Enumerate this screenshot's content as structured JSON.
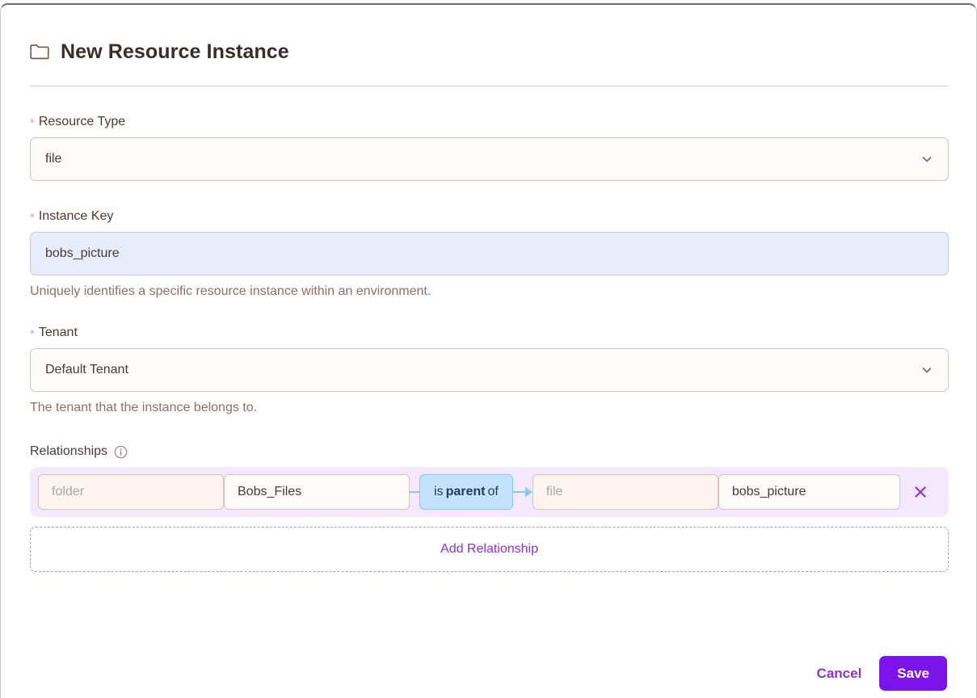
{
  "header": {
    "icon": "folder-icon",
    "title": "New Resource Instance"
  },
  "form": {
    "resource_type": {
      "label": "Resource Type",
      "required_marker": "*",
      "value": "file",
      "chevron": "chevron-down-icon"
    },
    "instance_key": {
      "label": "Instance Key",
      "required_marker": "*",
      "value": "bobs_picture",
      "help": "Uniquely identifies a specific resource instance within an environment."
    },
    "tenant": {
      "label": "Tenant",
      "required_marker": "*",
      "value": "Default Tenant",
      "chevron": "chevron-down-icon",
      "help": "The tenant that the instance belongs to."
    }
  },
  "relationships": {
    "label": "Relationships",
    "info_icon": "info-circle-icon",
    "rows": [
      {
        "subject_type_placeholder": "folder",
        "subject_key": "Bobs_Files",
        "relation_prefix": "is",
        "relation_name": "parent",
        "relation_suffix": "of",
        "object_type_placeholder": "file",
        "object_key": "bobs_picture",
        "remove_icon": "close-icon"
      }
    ],
    "add_label": "Add Relationship"
  },
  "footer": {
    "cancel_label": "Cancel",
    "save_label": "Save"
  },
  "colors": {
    "accent_purple": "#7a14e8",
    "link_purple": "#8b2fe0",
    "relation_blue_bg": "#c3e2fb",
    "relation_blue_border": "#8ec5f0",
    "relationship_row_bg": "#f4e8fc",
    "field_border": "#ddc3b6",
    "filled_field_bg": "#e6ecfa",
    "required_star": "#e8a79b",
    "text_primary": "#4a3a34",
    "text_help": "#8b7168"
  }
}
